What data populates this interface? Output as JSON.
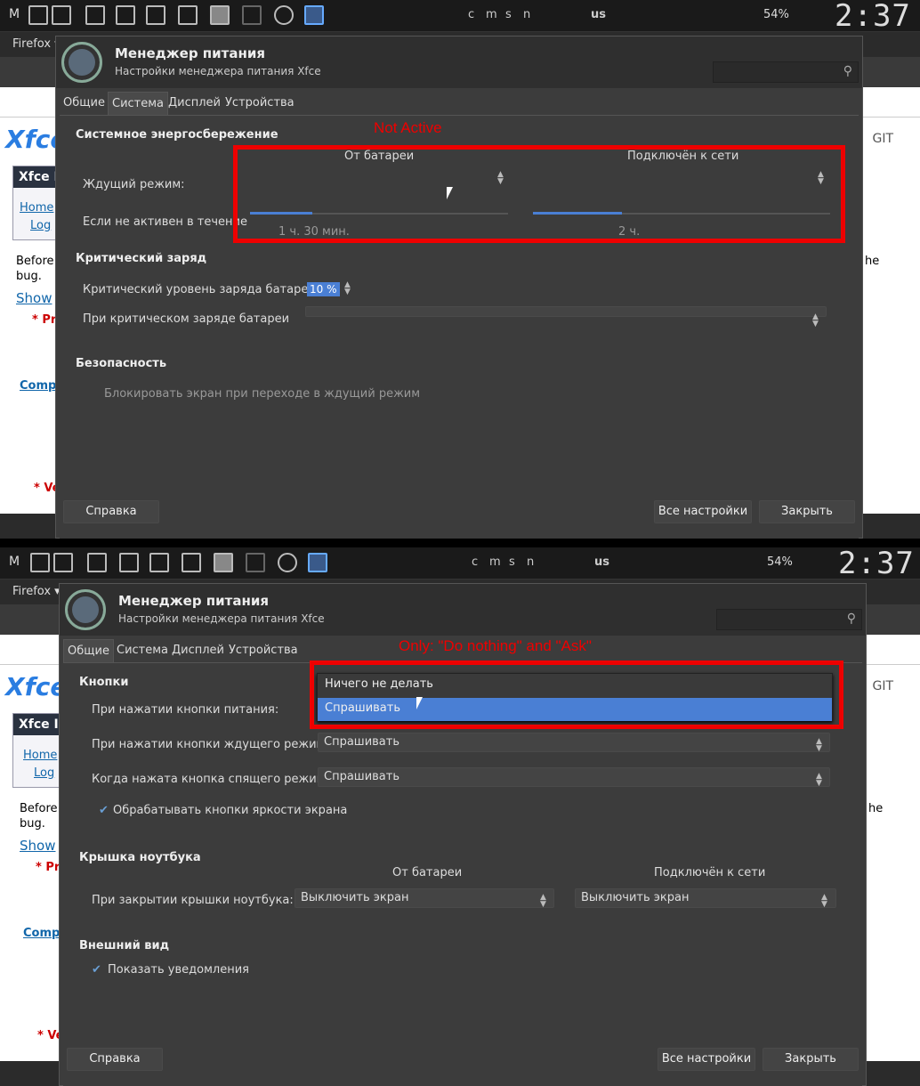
{
  "panel": {
    "m": "M",
    "kbd_c": "c",
    "kbd_m": "m",
    "kbd_s": "s",
    "kbd_n": "n",
    "layout": "us",
    "battery": "54%",
    "clock": "2:37"
  },
  "firefox": {
    "tab": "Firefox ▾",
    "logo": "Xfce",
    "git": "GIT",
    "box_head": "Xfce I",
    "home": "Home",
    "log": "Log",
    "before": "Before",
    "bug": "bug.",
    "show": "Show",
    "pr": "* Pr",
    "comp": "Comp",
    "ve": "* Ve",
    "he": "he"
  },
  "window": {
    "title": "Менеджер питания",
    "subtitle": "Настройки менеджера питания Xfce",
    "tabs": [
      "Общие",
      "Система",
      "Дисплей",
      "Устройства"
    ],
    "help": "Справка",
    "all_settings": "Все настройки",
    "close": "Закрыть"
  },
  "top": {
    "annotation": "Not Active",
    "sec1": "Системное энергосбережение",
    "col_battery": "От батареи",
    "col_ac": "Подключён к сети",
    "sleep_mode": "Ждущий режим:",
    "inactive_for": "Если не активен в течение",
    "val_battery": "1 ч. 30 мин.",
    "val_ac": "2 ч.",
    "slider_battery": 0.24,
    "slider_ac": 0.3,
    "sec2": "Критический заряд",
    "crit_level": "Критический уровень заряда батареи:",
    "crit_value": "10 %",
    "on_crit": "При критическом заряде батареи",
    "sec3": "Безопасность",
    "lock": "Блокировать экран при переходе в ждущий режим"
  },
  "bottom": {
    "annotation": "Only: \"Do nothing\" and \"Ask\"",
    "sec1": "Кнопки",
    "power_btn": "При нажатии кнопки питания:",
    "sleep_btn": "При нажатии кнопки ждущего режима:",
    "hib_btn": "Когда нажата кнопка спящего режима:",
    "ask": "Спрашивать",
    "do_nothing": "Ничего не делать",
    "brightness": "Обрабатывать кнопки яркости экрана",
    "sec2": "Крышка ноутбука",
    "col_battery": "От батареи",
    "col_ac": "Подключён к сети",
    "lid": "При закрытии крышки ноутбука:",
    "screen_off": "Выключить экран",
    "sec3": "Внешний вид",
    "notify": "Показать уведомления"
  }
}
